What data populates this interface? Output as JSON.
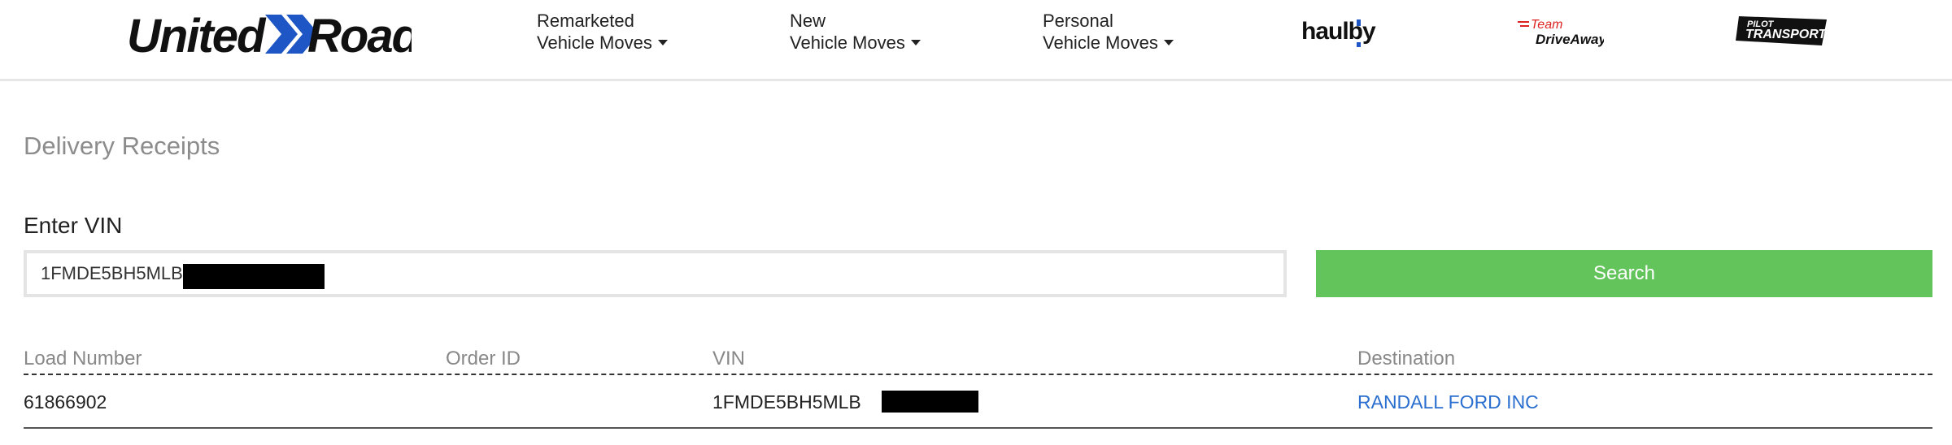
{
  "brand": {
    "name": "United Road",
    "part1": "United",
    "part2": "Road",
    "color_text": "#111111",
    "color_accent": "#1f56c5"
  },
  "nav": [
    {
      "line1": "Remarketed",
      "line2": "Vehicle Moves"
    },
    {
      "line1": "New",
      "line2": "Vehicle Moves"
    },
    {
      "line1": "Personal",
      "line2": "Vehicle Moves"
    }
  ],
  "partners": {
    "haulby": "haulby",
    "team_line1": "Team",
    "team_line2": "DriveAway",
    "pilot_line1": "PILOT",
    "pilot_line2": "TRANSPORT"
  },
  "page": {
    "title": "Delivery Receipts"
  },
  "vin_form": {
    "label": "Enter VIN",
    "value": "1FMDE5BH5MLB",
    "search_label": "Search",
    "search_color": "#63c45c"
  },
  "table": {
    "headers": {
      "load_number": "Load Number",
      "order_id": "Order ID",
      "vin": "VIN",
      "destination": "Destination"
    },
    "rows": [
      {
        "load_number": "61866902",
        "order_id": "",
        "vin": "1FMDE5BH5MLB",
        "destination": "RANDALL FORD INC"
      }
    ],
    "link_color": "#2a6fcf"
  }
}
